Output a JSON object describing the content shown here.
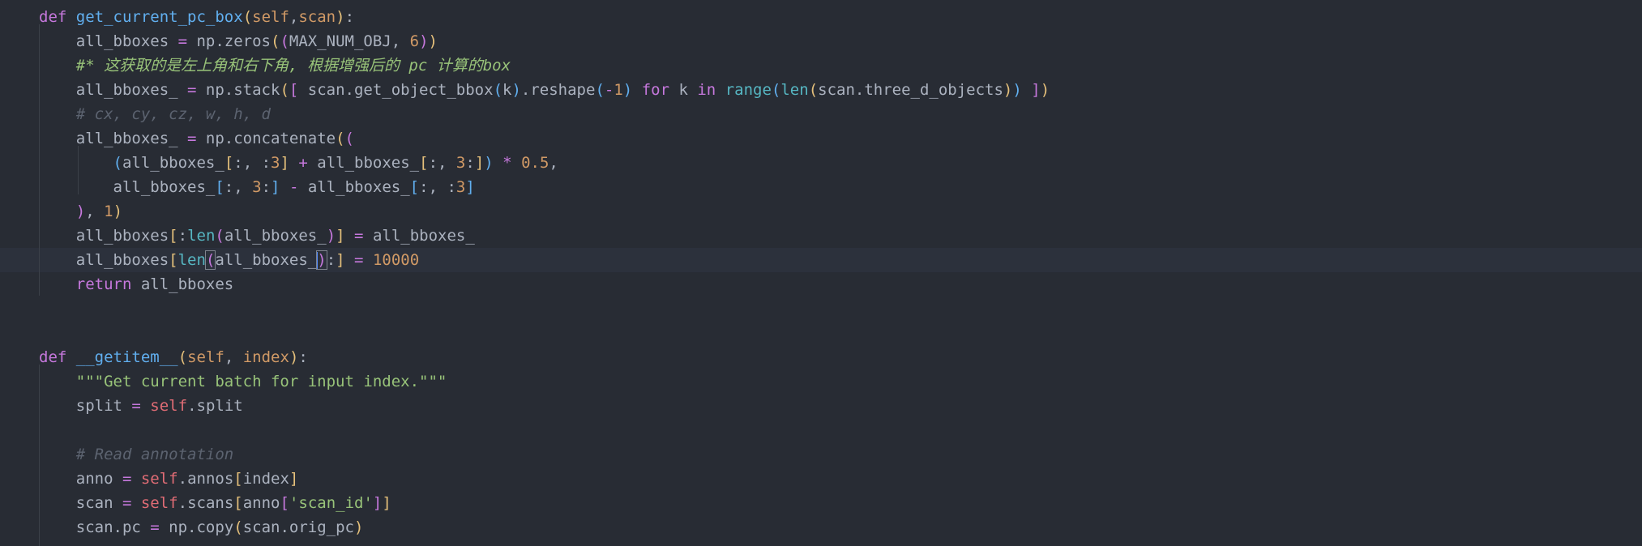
{
  "editor": {
    "language": "python",
    "theme": "one-dark",
    "cursor_line": 11,
    "lines": [
      {
        "n": 1,
        "tokens": [
          [
            "kw",
            "def"
          ],
          [
            "pl",
            " "
          ],
          [
            "fn",
            "get_current_pc_box"
          ],
          [
            "b1",
            "("
          ],
          [
            "pm",
            "self"
          ],
          [
            "pl",
            ","
          ],
          [
            "pm",
            "scan"
          ],
          [
            "b1",
            ")"
          ],
          [
            "pl",
            ":"
          ]
        ]
      },
      {
        "n": 2,
        "tokens": [
          [
            "pl",
            "    all_bboxes "
          ],
          [
            "op",
            "="
          ],
          [
            "pl",
            " np.zeros"
          ],
          [
            "b1",
            "("
          ],
          [
            "b2",
            "("
          ],
          [
            "pl",
            "MAX_NUM_OBJ, "
          ],
          [
            "nm",
            "6"
          ],
          [
            "b2",
            ")"
          ],
          [
            "b1",
            ")"
          ]
        ]
      },
      {
        "n": 3,
        "tokens": [
          [
            "pl",
            "    "
          ],
          [
            "cg",
            "#* 这获取的是左上角和右下角, 根据增强后的 pc 计算的box"
          ]
        ]
      },
      {
        "n": 4,
        "tokens": [
          [
            "pl",
            "    all_bboxes_ "
          ],
          [
            "op",
            "="
          ],
          [
            "pl",
            " np.stack"
          ],
          [
            "b1",
            "("
          ],
          [
            "b2",
            "["
          ],
          [
            "pl",
            " scan.get_object_bbox"
          ],
          [
            "b3",
            "("
          ],
          [
            "pl",
            "k"
          ],
          [
            "b3",
            ")"
          ],
          [
            "pl",
            ".reshape"
          ],
          [
            "b3",
            "("
          ],
          [
            "op",
            "-"
          ],
          [
            "nm",
            "1"
          ],
          [
            "b3",
            ")"
          ],
          [
            "pl",
            " "
          ],
          [
            "kw",
            "for"
          ],
          [
            "pl",
            " k "
          ],
          [
            "kw",
            "in"
          ],
          [
            "pl",
            " "
          ],
          [
            "bi",
            "range"
          ],
          [
            "b3",
            "("
          ],
          [
            "bi",
            "len"
          ],
          [
            "b1",
            "("
          ],
          [
            "pl",
            "scan.three_d_objects"
          ],
          [
            "b1",
            ")"
          ],
          [
            "b3",
            ")"
          ],
          [
            "pl",
            " "
          ],
          [
            "b2",
            "]"
          ],
          [
            "b1",
            ")"
          ]
        ]
      },
      {
        "n": 5,
        "tokens": [
          [
            "pl",
            "    "
          ],
          [
            "cm",
            "# cx, cy, cz, w, h, d"
          ]
        ]
      },
      {
        "n": 6,
        "tokens": [
          [
            "pl",
            "    all_bboxes_ "
          ],
          [
            "op",
            "="
          ],
          [
            "pl",
            " np.concatenate"
          ],
          [
            "b1",
            "("
          ],
          [
            "b2",
            "("
          ]
        ]
      },
      {
        "n": 7,
        "tokens": [
          [
            "pl",
            "        "
          ],
          [
            "b3",
            "("
          ],
          [
            "pl",
            "all_bboxes_"
          ],
          [
            "b1",
            "["
          ],
          [
            "pl",
            ":, :"
          ],
          [
            "nm",
            "3"
          ],
          [
            "b1",
            "]"
          ],
          [
            "pl",
            " "
          ],
          [
            "op",
            "+"
          ],
          [
            "pl",
            " all_bboxes_"
          ],
          [
            "b1",
            "["
          ],
          [
            "pl",
            ":, "
          ],
          [
            "nm",
            "3"
          ],
          [
            "pl",
            ":"
          ],
          [
            "b1",
            "]"
          ],
          [
            "b3",
            ")"
          ],
          [
            "pl",
            " "
          ],
          [
            "op",
            "*"
          ],
          [
            "pl",
            " "
          ],
          [
            "nm",
            "0.5"
          ],
          [
            "pl",
            ","
          ]
        ]
      },
      {
        "n": 8,
        "tokens": [
          [
            "pl",
            "        all_bboxes_"
          ],
          [
            "b3",
            "["
          ],
          [
            "pl",
            ":, "
          ],
          [
            "nm",
            "3"
          ],
          [
            "pl",
            ":"
          ],
          [
            "b3",
            "]"
          ],
          [
            "pl",
            " "
          ],
          [
            "op",
            "-"
          ],
          [
            "pl",
            " all_bboxes_"
          ],
          [
            "b3",
            "["
          ],
          [
            "pl",
            ":, :"
          ],
          [
            "nm",
            "3"
          ],
          [
            "b3",
            "]"
          ]
        ]
      },
      {
        "n": 9,
        "tokens": [
          [
            "pl",
            "    "
          ],
          [
            "b2",
            ")"
          ],
          [
            "pl",
            ", "
          ],
          [
            "nm",
            "1"
          ],
          [
            "b1",
            ")"
          ]
        ]
      },
      {
        "n": 10,
        "tokens": [
          [
            "pl",
            "    all_bboxes"
          ],
          [
            "b1",
            "["
          ],
          [
            "pl",
            ":"
          ],
          [
            "bi",
            "len"
          ],
          [
            "b2",
            "("
          ],
          [
            "pl",
            "all_bboxes_"
          ],
          [
            "b2",
            ")"
          ],
          [
            "b1",
            "]"
          ],
          [
            "pl",
            " "
          ],
          [
            "op",
            "="
          ],
          [
            "pl",
            " all_bboxes_"
          ]
        ]
      },
      {
        "n": 11,
        "tokens": [
          [
            "pl",
            "    all_bboxes"
          ],
          [
            "b1",
            "["
          ],
          [
            "bi",
            "len"
          ],
          [
            "b2m",
            "("
          ],
          [
            "pl",
            "all_bboxes_"
          ],
          [
            "cursor",
            ""
          ],
          [
            "b2m",
            ")"
          ],
          [
            "pl",
            ":"
          ],
          [
            "b1",
            "]"
          ],
          [
            "pl",
            " "
          ],
          [
            "op",
            "="
          ],
          [
            "pl",
            " "
          ],
          [
            "nm",
            "10000"
          ]
        ]
      },
      {
        "n": 12,
        "tokens": [
          [
            "pl",
            "    "
          ],
          [
            "kw",
            "return"
          ],
          [
            "pl",
            " all_bboxes"
          ]
        ]
      },
      {
        "n": 13,
        "tokens": []
      },
      {
        "n": 14,
        "tokens": []
      },
      {
        "n": 15,
        "tokens": [
          [
            "kw",
            "def"
          ],
          [
            "pl",
            " "
          ],
          [
            "fn",
            "__getitem__"
          ],
          [
            "b1",
            "("
          ],
          [
            "pm",
            "self"
          ],
          [
            "pl",
            ", "
          ],
          [
            "pm",
            "index"
          ],
          [
            "b1",
            ")"
          ],
          [
            "pl",
            ":"
          ]
        ]
      },
      {
        "n": 16,
        "tokens": [
          [
            "pl",
            "    "
          ],
          [
            "str",
            "\"\"\"Get current batch for input index.\"\"\""
          ]
        ]
      },
      {
        "n": 17,
        "tokens": [
          [
            "pl",
            "    split "
          ],
          [
            "op",
            "="
          ],
          [
            "pl",
            " "
          ],
          [
            "sf",
            "self"
          ],
          [
            "pl",
            ".split"
          ]
        ]
      },
      {
        "n": 18,
        "tokens": []
      },
      {
        "n": 19,
        "tokens": [
          [
            "pl",
            "    "
          ],
          [
            "cm",
            "# Read annotation"
          ]
        ]
      },
      {
        "n": 20,
        "tokens": [
          [
            "pl",
            "    anno "
          ],
          [
            "op",
            "="
          ],
          [
            "pl",
            " "
          ],
          [
            "sf",
            "self"
          ],
          [
            "pl",
            ".annos"
          ],
          [
            "b1",
            "["
          ],
          [
            "pl",
            "index"
          ],
          [
            "b1",
            "]"
          ]
        ]
      },
      {
        "n": 21,
        "tokens": [
          [
            "pl",
            "    scan "
          ],
          [
            "op",
            "="
          ],
          [
            "pl",
            " "
          ],
          [
            "sf",
            "self"
          ],
          [
            "pl",
            ".scans"
          ],
          [
            "b1",
            "["
          ],
          [
            "pl",
            "anno"
          ],
          [
            "b2",
            "["
          ],
          [
            "str",
            "'scan_id'"
          ],
          [
            "b2",
            "]"
          ],
          [
            "b1",
            "]"
          ]
        ]
      },
      {
        "n": 22,
        "tokens": [
          [
            "pl",
            "    scan.pc "
          ],
          [
            "op",
            "="
          ],
          [
            "pl",
            " np.copy"
          ],
          [
            "b1",
            "("
          ],
          [
            "pl",
            "scan.orig_pc"
          ],
          [
            "b1",
            ")"
          ]
        ]
      }
    ]
  }
}
